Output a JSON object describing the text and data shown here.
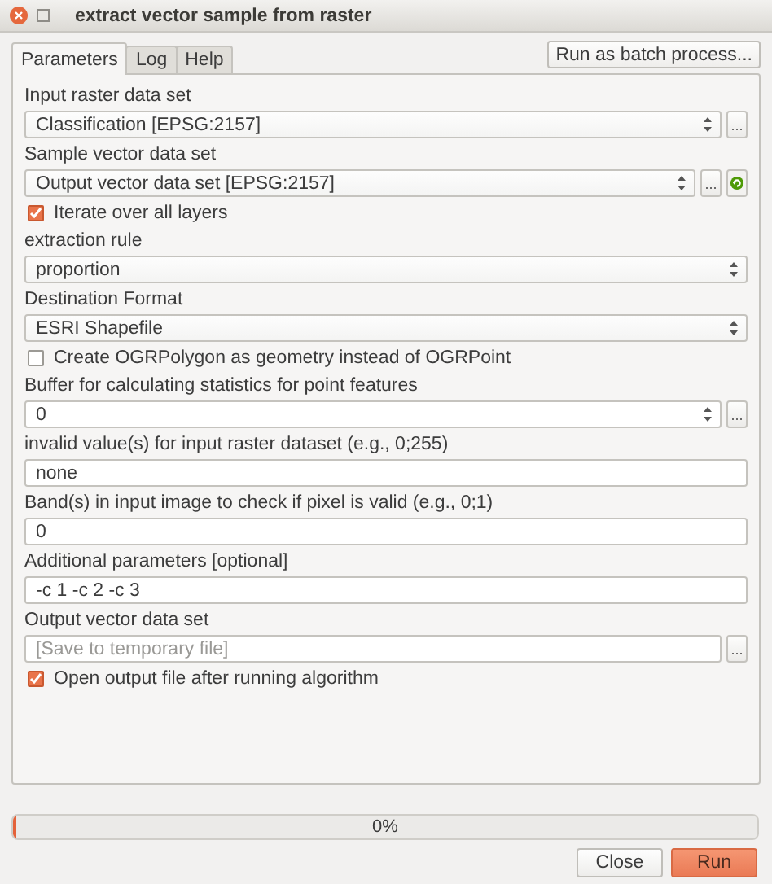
{
  "window": {
    "title": "extract vector sample from raster"
  },
  "tabs": [
    {
      "label": "Parameters",
      "selected": true
    },
    {
      "label": "Log",
      "selected": false
    },
    {
      "label": "Help",
      "selected": false
    }
  ],
  "batch_button": "Run as batch process...",
  "parameters": [
    {
      "kind": "combo",
      "label": "Input raster data set",
      "value": "Classification [EPSG:2157]",
      "browse_button": "...",
      "refresh": false
    },
    {
      "kind": "combo",
      "label": "Sample vector data set",
      "value": "Output vector data set [EPSG:2157]",
      "browse_button": "...",
      "refresh": true
    },
    {
      "kind": "checkbox",
      "label": "Iterate over all layers",
      "checked": true
    },
    {
      "kind": "combo",
      "label": "extraction rule",
      "value": "proportion",
      "refresh": false
    },
    {
      "kind": "combo",
      "label": "Destination Format",
      "value": "ESRI Shapefile",
      "refresh": false
    },
    {
      "kind": "checkbox",
      "label": "Create OGRPolygon as geometry instead of OGRPoint",
      "checked": false
    },
    {
      "kind": "spin",
      "label": "Buffer for calculating statistics for point features",
      "value": "0",
      "browse_button": "..."
    },
    {
      "kind": "text",
      "label": "invalid value(s) for input raster dataset (e.g., 0;255)",
      "value": "none"
    },
    {
      "kind": "text",
      "label": "Band(s) in input image to check if pixel is valid (e.g., 0;1)",
      "value": "0"
    },
    {
      "kind": "text",
      "label": "Additional parameters [optional]",
      "value": "-c 1 -c 2 -c 3"
    },
    {
      "kind": "file",
      "label": "Output vector data set",
      "placeholder": "[Save to temporary file]",
      "browse_button": "..."
    },
    {
      "kind": "checkbox",
      "label": "Open output file after running algorithm",
      "checked": true
    }
  ],
  "progress": {
    "level": 0,
    "text": "0%"
  },
  "buttons": [
    {
      "label": "Close",
      "kind": "default"
    },
    {
      "label": "Run",
      "kind": "primary"
    }
  ]
}
